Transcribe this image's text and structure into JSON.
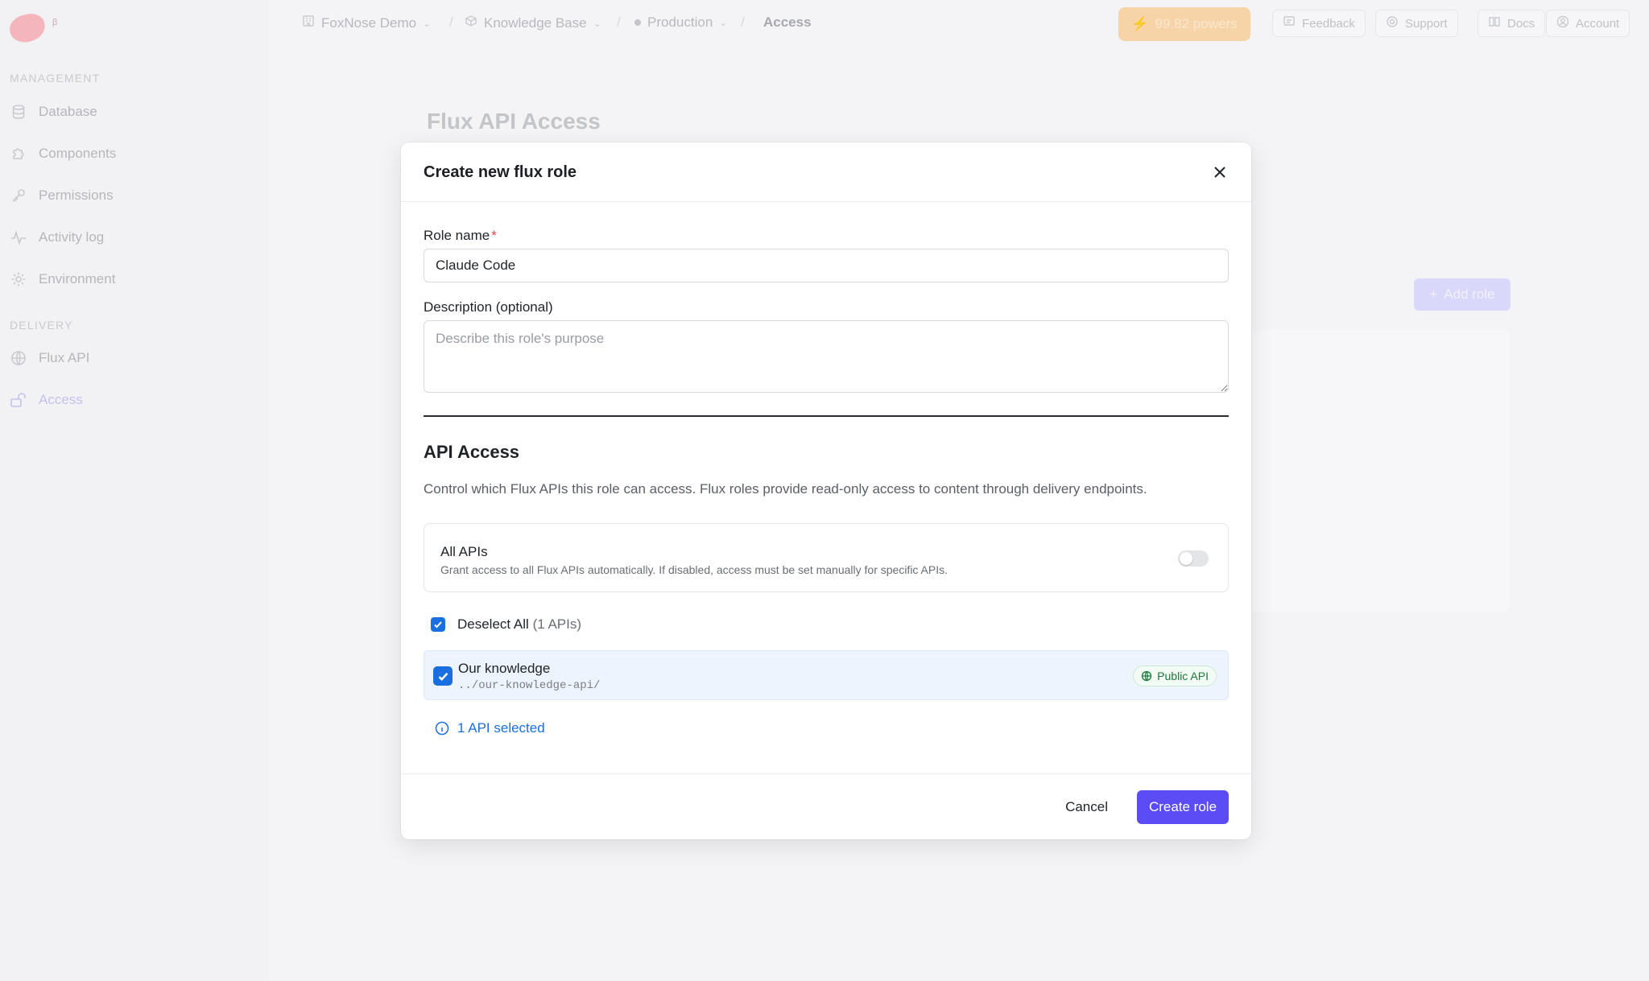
{
  "sidebar": {
    "beta_badge": "β",
    "management_label": "MANAGEMENT",
    "delivery_label": "DELIVERY",
    "items": [
      {
        "label": "Database",
        "icon": "database-icon"
      },
      {
        "label": "Components",
        "icon": "puzzle-icon"
      },
      {
        "label": "Permissions",
        "icon": "key-icon"
      },
      {
        "label": "Activity log",
        "icon": "activity-icon"
      },
      {
        "label": "Environment",
        "icon": "gear-icon"
      },
      {
        "label": "Flux API",
        "icon": "globe-icon"
      },
      {
        "label": "Access",
        "icon": "unlock-icon",
        "active": true
      }
    ]
  },
  "topbar": {
    "breadcrumbs": [
      {
        "label": "FoxNose Demo"
      },
      {
        "label": "Knowledge Base"
      },
      {
        "label": "Production"
      },
      {
        "label": "Access"
      }
    ],
    "powers": "99.82 powers",
    "buttons": {
      "feedback": "Feedback",
      "support": "Support",
      "docs": "Docs",
      "account": "Account"
    }
  },
  "page": {
    "title": "Flux API Access",
    "add_role": "Add role"
  },
  "modal": {
    "title": "Create new flux role",
    "role_name_label": "Role name",
    "required_mark": "*",
    "role_name_value": "Claude Code",
    "description_label": "Description (optional)",
    "description_placeholder": "Describe this role's purpose",
    "api_access_heading": "API Access",
    "api_access_desc": "Control which Flux APIs this role can access. Flux roles provide read-only access to content through delivery endpoints.",
    "all_apis": {
      "title": "All APIs",
      "desc": "Grant access to all Flux APIs automatically. If disabled, access must be set manually for specific APIs.",
      "enabled": false
    },
    "deselect_all": "Deselect All",
    "deselect_count": "(1 APIs)",
    "apis": [
      {
        "name": "Our knowledge",
        "path": "../our-knowledge-api/",
        "badge": "Public API",
        "selected": true
      }
    ],
    "selected_info": "1 API selected",
    "cancel": "Cancel",
    "create": "Create role"
  },
  "colors": {
    "primary": "#5b4cf5",
    "checkbox": "#1a6fe0",
    "public_badge": "#1d7a3a",
    "required": "#e5484d"
  }
}
